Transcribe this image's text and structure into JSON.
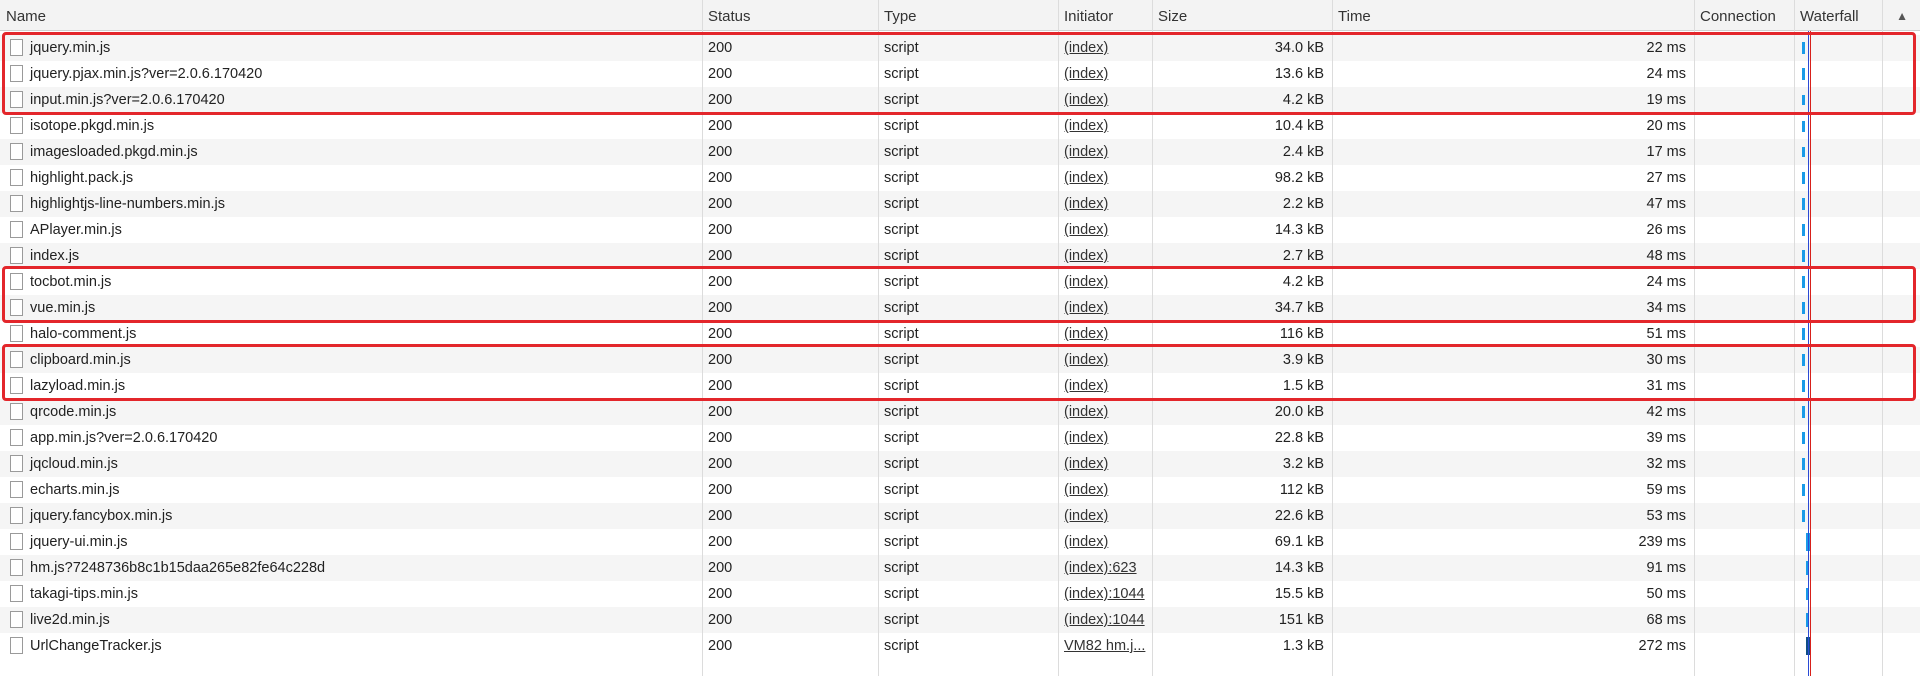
{
  "columns": {
    "name": "Name",
    "status": "Status",
    "type": "Type",
    "initiator": "Initiator",
    "size": "Size",
    "time": "Time",
    "connection": "Connection",
    "waterfall": "Waterfall"
  },
  "icons": {
    "sort": "sort-ascending-icon",
    "file": "file-icon"
  },
  "colors": {
    "highlight": "#e3262b",
    "waterfall_bar": "#1a9be8"
  },
  "requests": [
    {
      "name": "jquery.min.js",
      "status": "200",
      "type": "script",
      "initiator": "(index)",
      "size": "34.0 kB",
      "time": "22 ms"
    },
    {
      "name": "jquery.pjax.min.js?ver=2.0.6.170420",
      "status": "200",
      "type": "script",
      "initiator": "(index)",
      "size": "13.6 kB",
      "time": "24 ms"
    },
    {
      "name": "input.min.js?ver=2.0.6.170420",
      "status": "200",
      "type": "script",
      "initiator": "(index)",
      "size": "4.2 kB",
      "time": "19 ms"
    },
    {
      "name": "isotope.pkgd.min.js",
      "status": "200",
      "type": "script",
      "initiator": "(index)",
      "size": "10.4 kB",
      "time": "20 ms"
    },
    {
      "name": "imagesloaded.pkgd.min.js",
      "status": "200",
      "type": "script",
      "initiator": "(index)",
      "size": "2.4 kB",
      "time": "17 ms"
    },
    {
      "name": "highlight.pack.js",
      "status": "200",
      "type": "script",
      "initiator": "(index)",
      "size": "98.2 kB",
      "time": "27 ms"
    },
    {
      "name": "highlightjs-line-numbers.min.js",
      "status": "200",
      "type": "script",
      "initiator": "(index)",
      "size": "2.2 kB",
      "time": "47 ms"
    },
    {
      "name": "APlayer.min.js",
      "status": "200",
      "type": "script",
      "initiator": "(index)",
      "size": "14.3 kB",
      "time": "26 ms"
    },
    {
      "name": "index.js",
      "status": "200",
      "type": "script",
      "initiator": "(index)",
      "size": "2.7 kB",
      "time": "48 ms"
    },
    {
      "name": "tocbot.min.js",
      "status": "200",
      "type": "script",
      "initiator": "(index)",
      "size": "4.2 kB",
      "time": "24 ms"
    },
    {
      "name": "vue.min.js",
      "status": "200",
      "type": "script",
      "initiator": "(index)",
      "size": "34.7 kB",
      "time": "34 ms"
    },
    {
      "name": "halo-comment.js",
      "status": "200",
      "type": "script",
      "initiator": "(index)",
      "size": "116 kB",
      "time": "51 ms"
    },
    {
      "name": "clipboard.min.js",
      "status": "200",
      "type": "script",
      "initiator": "(index)",
      "size": "3.9 kB",
      "time": "30 ms"
    },
    {
      "name": "lazyload.min.js",
      "status": "200",
      "type": "script",
      "initiator": "(index)",
      "size": "1.5 kB",
      "time": "31 ms"
    },
    {
      "name": "qrcode.min.js",
      "status": "200",
      "type": "script",
      "initiator": "(index)",
      "size": "20.0 kB",
      "time": "42 ms"
    },
    {
      "name": "app.min.js?ver=2.0.6.170420",
      "status": "200",
      "type": "script",
      "initiator": "(index)",
      "size": "22.8 kB",
      "time": "39 ms"
    },
    {
      "name": "jqcloud.min.js",
      "status": "200",
      "type": "script",
      "initiator": "(index)",
      "size": "3.2 kB",
      "time": "32 ms"
    },
    {
      "name": "echarts.min.js",
      "status": "200",
      "type": "script",
      "initiator": "(index)",
      "size": "112 kB",
      "time": "59 ms"
    },
    {
      "name": "jquery.fancybox.min.js",
      "status": "200",
      "type": "script",
      "initiator": "(index)",
      "size": "22.6 kB",
      "time": "53 ms"
    },
    {
      "name": "jquery-ui.min.js",
      "status": "200",
      "type": "script",
      "initiator": "(index)",
      "size": "69.1 kB",
      "time": "239 ms"
    },
    {
      "name": "hm.js?7248736b8c1b15daa265e82fe64c228d",
      "status": "200",
      "type": "script",
      "initiator": "(index):623",
      "size": "14.3 kB",
      "time": "91 ms"
    },
    {
      "name": "takagi-tips.min.js",
      "status": "200",
      "type": "script",
      "initiator": "(index):1044",
      "size": "15.5 kB",
      "time": "50 ms"
    },
    {
      "name": "live2d.min.js",
      "status": "200",
      "type": "script",
      "initiator": "(index):1044",
      "size": "151 kB",
      "time": "68 ms"
    },
    {
      "name": "UrlChangeTracker.js",
      "status": "200",
      "type": "script",
      "initiator": "VM82 hm.j...",
      "size": "1.3 kB",
      "time": "272 ms"
    }
  ],
  "highlight_groups": [
    [
      0,
      2
    ],
    [
      9,
      10
    ],
    [
      12,
      13
    ]
  ]
}
